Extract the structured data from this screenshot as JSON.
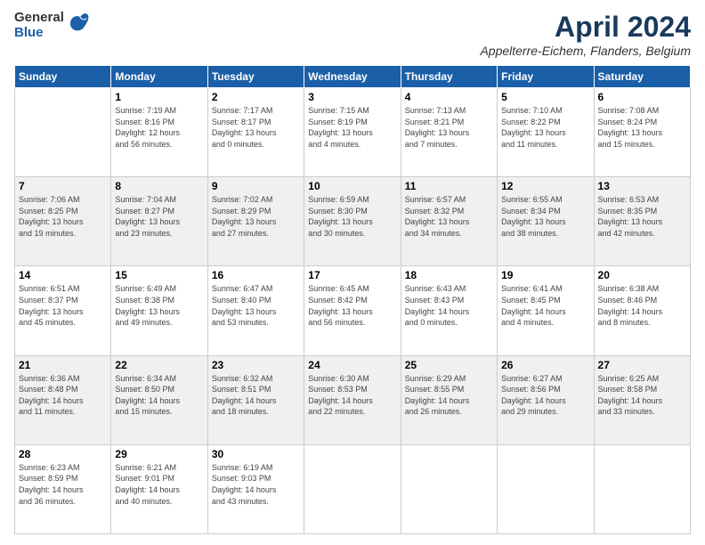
{
  "header": {
    "logo_general": "General",
    "logo_blue": "Blue",
    "month_year": "April 2024",
    "location": "Appelterre-Eichem, Flanders, Belgium"
  },
  "days_of_week": [
    "Sunday",
    "Monday",
    "Tuesday",
    "Wednesday",
    "Thursday",
    "Friday",
    "Saturday"
  ],
  "weeks": [
    [
      {
        "day": "",
        "info": ""
      },
      {
        "day": "1",
        "info": "Sunrise: 7:19 AM\nSunset: 8:16 PM\nDaylight: 12 hours\nand 56 minutes."
      },
      {
        "day": "2",
        "info": "Sunrise: 7:17 AM\nSunset: 8:17 PM\nDaylight: 13 hours\nand 0 minutes."
      },
      {
        "day": "3",
        "info": "Sunrise: 7:15 AM\nSunset: 8:19 PM\nDaylight: 13 hours\nand 4 minutes."
      },
      {
        "day": "4",
        "info": "Sunrise: 7:13 AM\nSunset: 8:21 PM\nDaylight: 13 hours\nand 7 minutes."
      },
      {
        "day": "5",
        "info": "Sunrise: 7:10 AM\nSunset: 8:22 PM\nDaylight: 13 hours\nand 11 minutes."
      },
      {
        "day": "6",
        "info": "Sunrise: 7:08 AM\nSunset: 8:24 PM\nDaylight: 13 hours\nand 15 minutes."
      }
    ],
    [
      {
        "day": "7",
        "info": "Sunrise: 7:06 AM\nSunset: 8:25 PM\nDaylight: 13 hours\nand 19 minutes."
      },
      {
        "day": "8",
        "info": "Sunrise: 7:04 AM\nSunset: 8:27 PM\nDaylight: 13 hours\nand 23 minutes."
      },
      {
        "day": "9",
        "info": "Sunrise: 7:02 AM\nSunset: 8:29 PM\nDaylight: 13 hours\nand 27 minutes."
      },
      {
        "day": "10",
        "info": "Sunrise: 6:59 AM\nSunset: 8:30 PM\nDaylight: 13 hours\nand 30 minutes."
      },
      {
        "day": "11",
        "info": "Sunrise: 6:57 AM\nSunset: 8:32 PM\nDaylight: 13 hours\nand 34 minutes."
      },
      {
        "day": "12",
        "info": "Sunrise: 6:55 AM\nSunset: 8:34 PM\nDaylight: 13 hours\nand 38 minutes."
      },
      {
        "day": "13",
        "info": "Sunrise: 6:53 AM\nSunset: 8:35 PM\nDaylight: 13 hours\nand 42 minutes."
      }
    ],
    [
      {
        "day": "14",
        "info": "Sunrise: 6:51 AM\nSunset: 8:37 PM\nDaylight: 13 hours\nand 45 minutes."
      },
      {
        "day": "15",
        "info": "Sunrise: 6:49 AM\nSunset: 8:38 PM\nDaylight: 13 hours\nand 49 minutes."
      },
      {
        "day": "16",
        "info": "Sunrise: 6:47 AM\nSunset: 8:40 PM\nDaylight: 13 hours\nand 53 minutes."
      },
      {
        "day": "17",
        "info": "Sunrise: 6:45 AM\nSunset: 8:42 PM\nDaylight: 13 hours\nand 56 minutes."
      },
      {
        "day": "18",
        "info": "Sunrise: 6:43 AM\nSunset: 8:43 PM\nDaylight: 14 hours\nand 0 minutes."
      },
      {
        "day": "19",
        "info": "Sunrise: 6:41 AM\nSunset: 8:45 PM\nDaylight: 14 hours\nand 4 minutes."
      },
      {
        "day": "20",
        "info": "Sunrise: 6:38 AM\nSunset: 8:46 PM\nDaylight: 14 hours\nand 8 minutes."
      }
    ],
    [
      {
        "day": "21",
        "info": "Sunrise: 6:36 AM\nSunset: 8:48 PM\nDaylight: 14 hours\nand 11 minutes."
      },
      {
        "day": "22",
        "info": "Sunrise: 6:34 AM\nSunset: 8:50 PM\nDaylight: 14 hours\nand 15 minutes."
      },
      {
        "day": "23",
        "info": "Sunrise: 6:32 AM\nSunset: 8:51 PM\nDaylight: 14 hours\nand 18 minutes."
      },
      {
        "day": "24",
        "info": "Sunrise: 6:30 AM\nSunset: 8:53 PM\nDaylight: 14 hours\nand 22 minutes."
      },
      {
        "day": "25",
        "info": "Sunrise: 6:29 AM\nSunset: 8:55 PM\nDaylight: 14 hours\nand 26 minutes."
      },
      {
        "day": "26",
        "info": "Sunrise: 6:27 AM\nSunset: 8:56 PM\nDaylight: 14 hours\nand 29 minutes."
      },
      {
        "day": "27",
        "info": "Sunrise: 6:25 AM\nSunset: 8:58 PM\nDaylight: 14 hours\nand 33 minutes."
      }
    ],
    [
      {
        "day": "28",
        "info": "Sunrise: 6:23 AM\nSunset: 8:59 PM\nDaylight: 14 hours\nand 36 minutes."
      },
      {
        "day": "29",
        "info": "Sunrise: 6:21 AM\nSunset: 9:01 PM\nDaylight: 14 hours\nand 40 minutes."
      },
      {
        "day": "30",
        "info": "Sunrise: 6:19 AM\nSunset: 9:03 PM\nDaylight: 14 hours\nand 43 minutes."
      },
      {
        "day": "",
        "info": ""
      },
      {
        "day": "",
        "info": ""
      },
      {
        "day": "",
        "info": ""
      },
      {
        "day": "",
        "info": ""
      }
    ]
  ]
}
